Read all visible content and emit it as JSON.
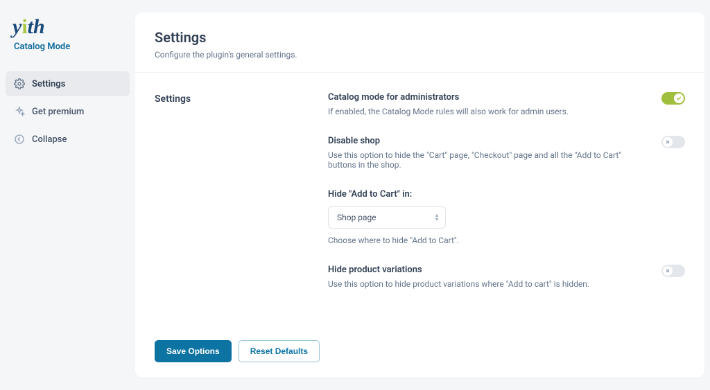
{
  "logo": {
    "text": "yith"
  },
  "pluginName": "Catalog Mode",
  "sidebar": {
    "items": [
      {
        "label": "Settings",
        "active": true
      },
      {
        "label": "Get premium",
        "active": false
      },
      {
        "label": "Collapse",
        "active": false
      }
    ]
  },
  "page": {
    "title": "Settings",
    "subtitle": "Configure the plugin's general settings."
  },
  "section": {
    "label": "Settings",
    "fields": {
      "catalogMode": {
        "label": "Catalog mode for administrators",
        "help": "If enabled, the Catalog Mode rules will also work for admin users.",
        "value": true
      },
      "disableShop": {
        "label": "Disable shop",
        "help": "Use this option to hide the \"Cart\" page, \"Checkout\" page and all the \"Add to Cart\" buttons in the shop.",
        "value": false
      },
      "hideAddToCart": {
        "label": "Hide \"Add to Cart\" in:",
        "selected": "Shop page",
        "help": "Choose where to hide \"Add to Cart\"."
      },
      "hideVariations": {
        "label": "Hide product variations",
        "help": "Use this option to hide product variations where \"Add to cart\" is hidden.",
        "value": false
      }
    }
  },
  "footer": {
    "save": "Save Options",
    "reset": "Reset Defaults"
  }
}
